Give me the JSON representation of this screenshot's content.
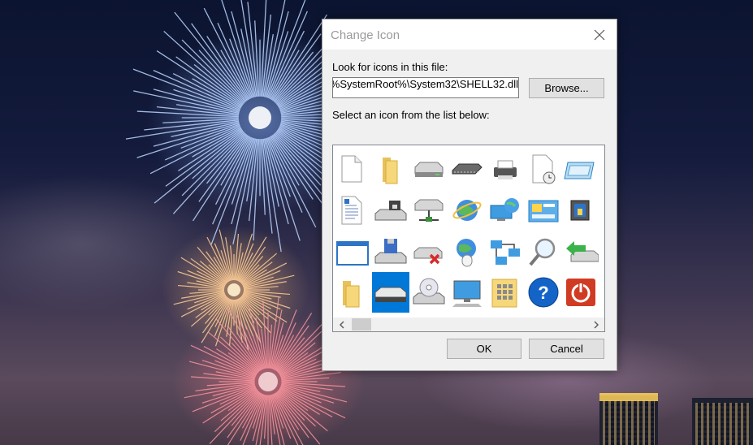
{
  "dialog": {
    "title": "Change Icon",
    "look_for_label": "Look for icons in this file:",
    "file_path": "%SystemRoot%\\System32\\SHELL32.dll",
    "browse_label": "Browse...",
    "select_label": "Select an icon from the list below:",
    "ok_label": "OK",
    "cancel_label": "Cancel"
  },
  "icons": [
    [
      "blank-document-icon",
      "folder-icon",
      "hard-drive-icon",
      "memory-chip-icon",
      "printer-icon",
      "document-clock-icon",
      "window-frame-icon"
    ],
    [
      "text-document-icon",
      "drive-with-lock-icon",
      "network-drive-icon",
      "internet-globe-icon",
      "network-computer-icon",
      "control-panel-icon",
      "computer-tower-icon"
    ],
    [
      "application-window-icon",
      "floppy-drive-icon",
      "disconnected-drive-icon",
      "network-globe-mouse-icon",
      "network-connections-icon",
      "magnifier-icon",
      "green-arrow-drive-icon"
    ],
    [
      "folder-open-icon",
      "removable-drive-icon",
      "cd-drive-icon",
      "desktop-computer-icon",
      "grid-folder-icon",
      "help-icon",
      "power-icon"
    ]
  ],
  "selected_icon": "removable-drive-icon",
  "colors": {
    "selection": "#0078d7",
    "help_blue": "#1464c8",
    "power_red": "#d03b23"
  }
}
